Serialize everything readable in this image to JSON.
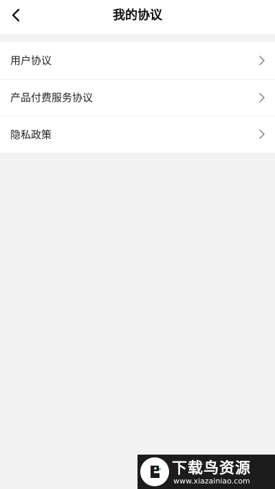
{
  "navbar": {
    "title": "我的协议",
    "back_icon": "chevron-left-icon"
  },
  "agreements": [
    {
      "label": "用户协议",
      "icon": "chevron-right-icon"
    },
    {
      "label": "产品付费服务协议",
      "icon": "chevron-right-icon"
    },
    {
      "label": "隐私政策",
      "icon": "chevron-right-icon"
    }
  ],
  "watermark": {
    "title": "下载鸟资源",
    "url": "www.xiazainiao.com",
    "logo_icon": "bird-logo-icon"
  },
  "colors": {
    "background": "#f2f2f2",
    "surface": "#ffffff",
    "text": "#222222",
    "chevron": "#8a8a8a",
    "watermark_bg": "#1c1c1c"
  }
}
